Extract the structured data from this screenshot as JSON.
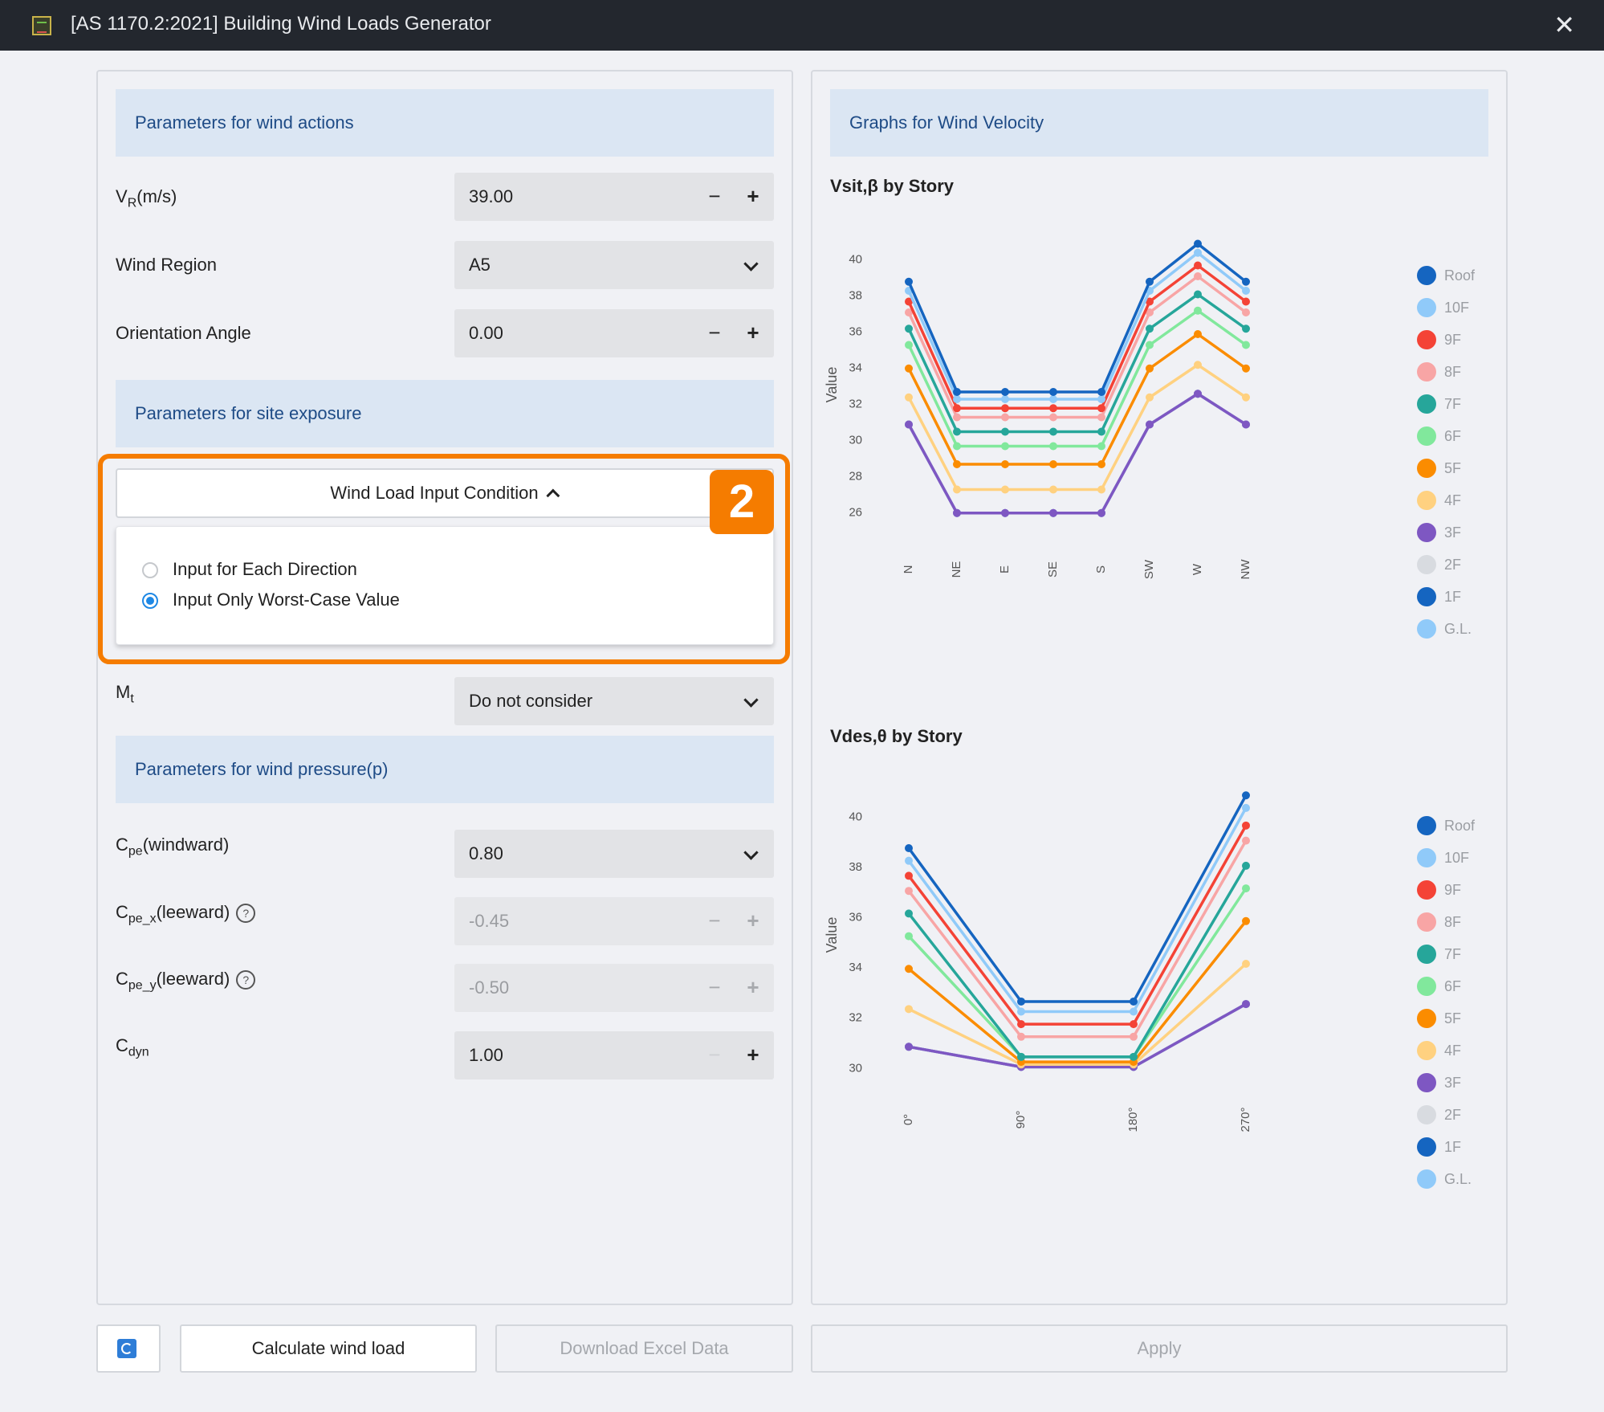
{
  "window": {
    "title": "[AS 1170.2:2021] Building Wind Loads Generator"
  },
  "left": {
    "section1": "Parameters for wind actions",
    "vr": {
      "label_main": "V",
      "label_sub": "R",
      "label_tail": "(m/s)",
      "value": "39.00"
    },
    "wind_region": {
      "label": "Wind Region",
      "value": "A5"
    },
    "orientation": {
      "label": "Orientation Angle",
      "value": "0.00"
    },
    "section2": "Parameters for site exposure",
    "condition": {
      "title": "Wind Load Input Condition",
      "option1": "Input for Each Direction",
      "option2": "Input Only Worst-Case Value",
      "badge": "2"
    },
    "mt": {
      "label_main": "M",
      "label_sub": "t",
      "value": "Do not consider"
    },
    "section3": "Parameters for wind pressure(p)",
    "cpe_w": {
      "label_main": "C",
      "label_sub": "pe",
      "label_tail": "(windward)",
      "value": "0.80"
    },
    "cpe_x": {
      "label_main": "C",
      "label_sub": "pe_x",
      "label_tail": "(leeward)",
      "value": "-0.45"
    },
    "cpe_y": {
      "label_main": "C",
      "label_sub": "pe_y",
      "label_tail": "(leeward)",
      "value": "-0.50"
    },
    "cdyn": {
      "label_main": "C",
      "label_sub": "dyn",
      "value": "1.00"
    }
  },
  "right": {
    "section": "Graphs for Wind Velocity"
  },
  "buttons": {
    "calculate": "Calculate wind load",
    "download": "Download Excel Data",
    "apply": "Apply"
  },
  "chart_data": [
    {
      "type": "line",
      "title": "Vsit,β by Story",
      "ylabel": "Value",
      "xlabel": "",
      "ylim": [
        25,
        41
      ],
      "yticks": [
        26,
        28,
        30,
        32,
        34,
        36,
        38,
        40
      ],
      "categories": [
        "N",
        "NE",
        "E",
        "SE",
        "S",
        "SW",
        "W",
        "NW"
      ],
      "legend": "right",
      "series": [
        {
          "name": "Roof",
          "color": "#1565c0",
          "values": [
            38.7,
            32.6,
            32.6,
            32.6,
            32.6,
            38.7,
            40.8,
            38.7
          ]
        },
        {
          "name": "10F",
          "color": "#90caf9",
          "values": [
            38.2,
            32.2,
            32.2,
            32.2,
            32.2,
            38.2,
            40.3,
            38.2
          ]
        },
        {
          "name": "9F",
          "color": "#f44336",
          "values": [
            37.6,
            31.7,
            31.7,
            31.7,
            31.7,
            37.6,
            39.6,
            37.6
          ]
        },
        {
          "name": "8F",
          "color": "#f8a5a5",
          "values": [
            37.0,
            31.2,
            31.2,
            31.2,
            31.2,
            37.0,
            39.0,
            37.0
          ]
        },
        {
          "name": "7F",
          "color": "#26a69a",
          "values": [
            36.1,
            30.4,
            30.4,
            30.4,
            30.4,
            36.1,
            38.0,
            36.1
          ]
        },
        {
          "name": "6F",
          "color": "#81e89c",
          "values": [
            35.2,
            29.6,
            29.6,
            29.6,
            29.6,
            35.2,
            37.1,
            35.2
          ]
        },
        {
          "name": "5F",
          "color": "#fb8c00",
          "values": [
            33.9,
            28.6,
            28.6,
            28.6,
            28.6,
            33.9,
            35.8,
            33.9
          ]
        },
        {
          "name": "4F",
          "color": "#ffd180",
          "values": [
            32.3,
            27.2,
            27.2,
            27.2,
            27.2,
            32.3,
            34.1,
            32.3
          ]
        },
        {
          "name": "3F",
          "color": "#7e57c2",
          "values": [
            30.8,
            25.9,
            25.9,
            25.9,
            25.9,
            30.8,
            32.5,
            30.8
          ]
        },
        {
          "name": "2F",
          "color": "#d8dbe0",
          "values": [
            30.8,
            25.9,
            25.9,
            25.9,
            25.9,
            30.8,
            32.5,
            30.8
          ]
        },
        {
          "name": "1F",
          "color": "#1565c0",
          "values": [
            30.8,
            25.9,
            25.9,
            25.9,
            25.9,
            30.8,
            32.5,
            30.8
          ]
        },
        {
          "name": "G.L.",
          "color": "#90caf9",
          "values": [
            30.8,
            25.9,
            25.9,
            25.9,
            25.9,
            30.8,
            32.5,
            30.8
          ]
        }
      ]
    },
    {
      "type": "line",
      "title": "Vdes,θ by Story",
      "ylabel": "Value",
      "xlabel": "",
      "ylim": [
        29.5,
        41
      ],
      "yticks": [
        30,
        32,
        34,
        36,
        38,
        40
      ],
      "categories": [
        "0°",
        "90°",
        "180°",
        "270°"
      ],
      "legend": "right",
      "series": [
        {
          "name": "Roof",
          "color": "#1565c0",
          "values": [
            38.7,
            32.6,
            32.6,
            40.8
          ]
        },
        {
          "name": "10F",
          "color": "#90caf9",
          "values": [
            38.2,
            32.2,
            32.2,
            40.3
          ]
        },
        {
          "name": "9F",
          "color": "#f44336",
          "values": [
            37.6,
            31.7,
            31.7,
            39.6
          ]
        },
        {
          "name": "8F",
          "color": "#f8a5a5",
          "values": [
            37.0,
            31.2,
            31.2,
            39.0
          ]
        },
        {
          "name": "7F",
          "color": "#26a69a",
          "values": [
            36.1,
            30.4,
            30.4,
            38.0
          ]
        },
        {
          "name": "6F",
          "color": "#81e89c",
          "values": [
            35.2,
            30.4,
            30.4,
            37.1
          ]
        },
        {
          "name": "5F",
          "color": "#fb8c00",
          "values": [
            33.9,
            30.2,
            30.2,
            35.8
          ]
        },
        {
          "name": "4F",
          "color": "#ffd180",
          "values": [
            32.3,
            30.1,
            30.1,
            34.1
          ]
        },
        {
          "name": "3F",
          "color": "#7e57c2",
          "values": [
            30.8,
            30.0,
            30.0,
            32.5
          ]
        },
        {
          "name": "2F",
          "color": "#d8dbe0",
          "values": [
            30.8,
            30.0,
            30.0,
            32.5
          ]
        },
        {
          "name": "1F",
          "color": "#1565c0",
          "values": [
            30.8,
            30.0,
            30.0,
            32.5
          ]
        },
        {
          "name": "G.L.",
          "color": "#90caf9",
          "values": [
            30.8,
            30.0,
            30.0,
            32.5
          ]
        }
      ]
    }
  ]
}
